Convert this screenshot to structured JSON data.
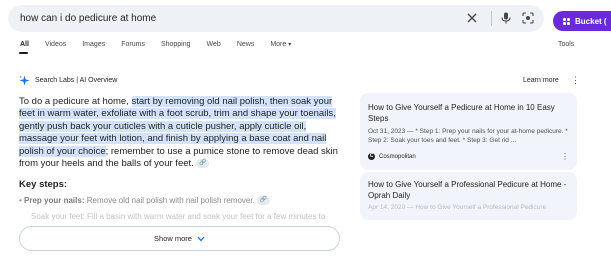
{
  "search": {
    "query": "how can i do pedicure at home"
  },
  "bucket": {
    "label": "Bucket ("
  },
  "tabs": [
    {
      "label": "All"
    },
    {
      "label": "Videos"
    },
    {
      "label": "Images"
    },
    {
      "label": "Forums"
    },
    {
      "label": "Shopping"
    },
    {
      "label": "Web"
    },
    {
      "label": "News"
    },
    {
      "label": "More"
    }
  ],
  "tools_label": "Tools",
  "overview": {
    "header": "Search Labs | AI Overview",
    "learn_more": "Learn more",
    "summary_lead": "To do a pedicure at home, ",
    "summary_highlight": "start by removing old nail polish, then soak your feet in warm water, exfoliate with a foot scrub, trim and shape your toenails, gently push back your cuticles with a cuticle pusher, apply cuticle oil, massage your feet with lotion, and finish by applying a base coat and nail polish of your choice",
    "summary_tail": "; remember to use a pumice stone to remove dead skin from your heels and the balls of your feet.",
    "key_steps_heading": "Key steps:",
    "step1_label": "Prep your nails:",
    "step1_text": " Remove old nail polish with nail polish remover.",
    "step2_text": "Soak your feet: Fill a basin with warm water and soak your feet for a few minutes to",
    "show_more": "Show more"
  },
  "sources": [
    {
      "title": "How to Give Yourself a Pedicure at Home in 10 Easy Steps",
      "date": "Oct 31, 2023",
      "snippet": " — * Step 1: Prep your nails for your at-home pedicure. * Step 2: Soak your toes and feet. * Step 3: Get rid ...",
      "source": "Cosmopolitan",
      "logo_letter": "C"
    },
    {
      "title": "How to Give Yourself a Professional Pedicure at Home - Oprah Daily",
      "date": "Apr 14, 2020",
      "snippet": " — How to Give Yourself a Professional Pedicure"
    }
  ],
  "colors": {
    "accent": "#6a2ad8",
    "highlight": "#d3e3fd",
    "card_bg": "#f1f4fa"
  }
}
